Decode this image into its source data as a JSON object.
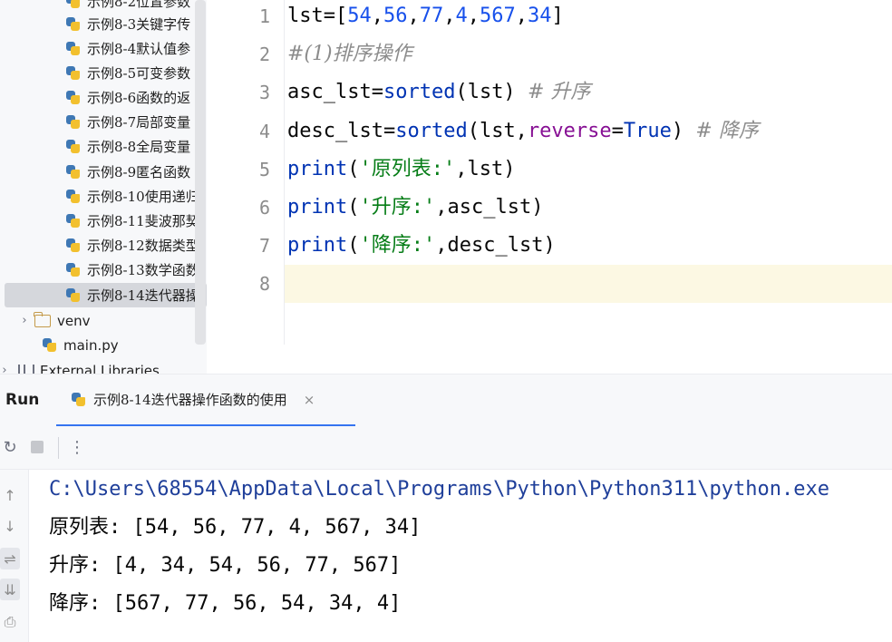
{
  "project_tree": {
    "items": [
      {
        "label": "示例8-2位置参数",
        "type": "py"
      },
      {
        "label": "示例8-3关键字传",
        "type": "py"
      },
      {
        "label": "示例8-4默认值参",
        "type": "py"
      },
      {
        "label": "示例8-5可变参数",
        "type": "py"
      },
      {
        "label": "示例8-6函数的返",
        "type": "py"
      },
      {
        "label": "示例8-7局部变量",
        "type": "py"
      },
      {
        "label": "示例8-8全局变量",
        "type": "py"
      },
      {
        "label": "示例8-9匿名函数",
        "type": "py"
      },
      {
        "label": "示例8-10使用递归",
        "type": "py"
      },
      {
        "label": "示例8-11斐波那契",
        "type": "py"
      },
      {
        "label": "示例8-12数据类型",
        "type": "py"
      },
      {
        "label": "示例8-13数学函数",
        "type": "py"
      },
      {
        "label": "示例8-14迭代器操",
        "type": "py",
        "selected": true
      }
    ],
    "venv_label": "venv",
    "main_label": "main.py",
    "external_label": "External Libraries"
  },
  "editor": {
    "line_numbers": [
      "1",
      "2",
      "3",
      "4",
      "5",
      "6",
      "7",
      "8"
    ],
    "lines": {
      "l1": {
        "a": "lst=[",
        "n1": "54",
        "c1": ",",
        "n2": "56",
        "c2": ",",
        "n3": "77",
        "c3": ",",
        "n4": "4",
        "c4": ",",
        "n5": "567",
        "c5": ",",
        "n6": "34",
        "e": "]"
      },
      "l2": {
        "comment": "#(1)排序操作"
      },
      "l3": {
        "a": "asc_lst=",
        "fn": "sorted",
        "b": "(lst) ",
        "comment": "# 升序"
      },
      "l4": {
        "a": "desc_lst=",
        "fn": "sorted",
        "b": "(lst,",
        "param": "reverse",
        "eq": "=",
        "kw": "True",
        "c": ") ",
        "comment": "# 降序"
      },
      "l5": {
        "fn": "print",
        "a": "(",
        "str": "'原列表:'",
        "b": ",lst)"
      },
      "l6": {
        "fn": "print",
        "a": "(",
        "str": "'升序:'",
        "b": ",asc_lst)"
      },
      "l7": {
        "fn": "print",
        "a": "(",
        "str": "'降序:'",
        "b": ",desc_lst)"
      }
    }
  },
  "run_panel": {
    "title": "Run",
    "tab_label": "示例8-14迭代器操作函数的使用",
    "tab_close": "×",
    "more_icon": "⋮",
    "output": [
      "C:\\Users\\68554\\AppData\\Local\\Programs\\Python\\Python311\\python.exe",
      "原列表: [54, 56, 77, 4, 567, 34]",
      "升序: [4, 34, 54, 56, 77, 567]",
      "降序: [567, 77, 56, 54, 34, 4]"
    ]
  },
  "colors": {
    "number": "#1750eb",
    "function": "#0033b3",
    "string": "#067d17",
    "param": "#871094",
    "comment": "#8c8c8c",
    "accent": "#3574f0"
  }
}
